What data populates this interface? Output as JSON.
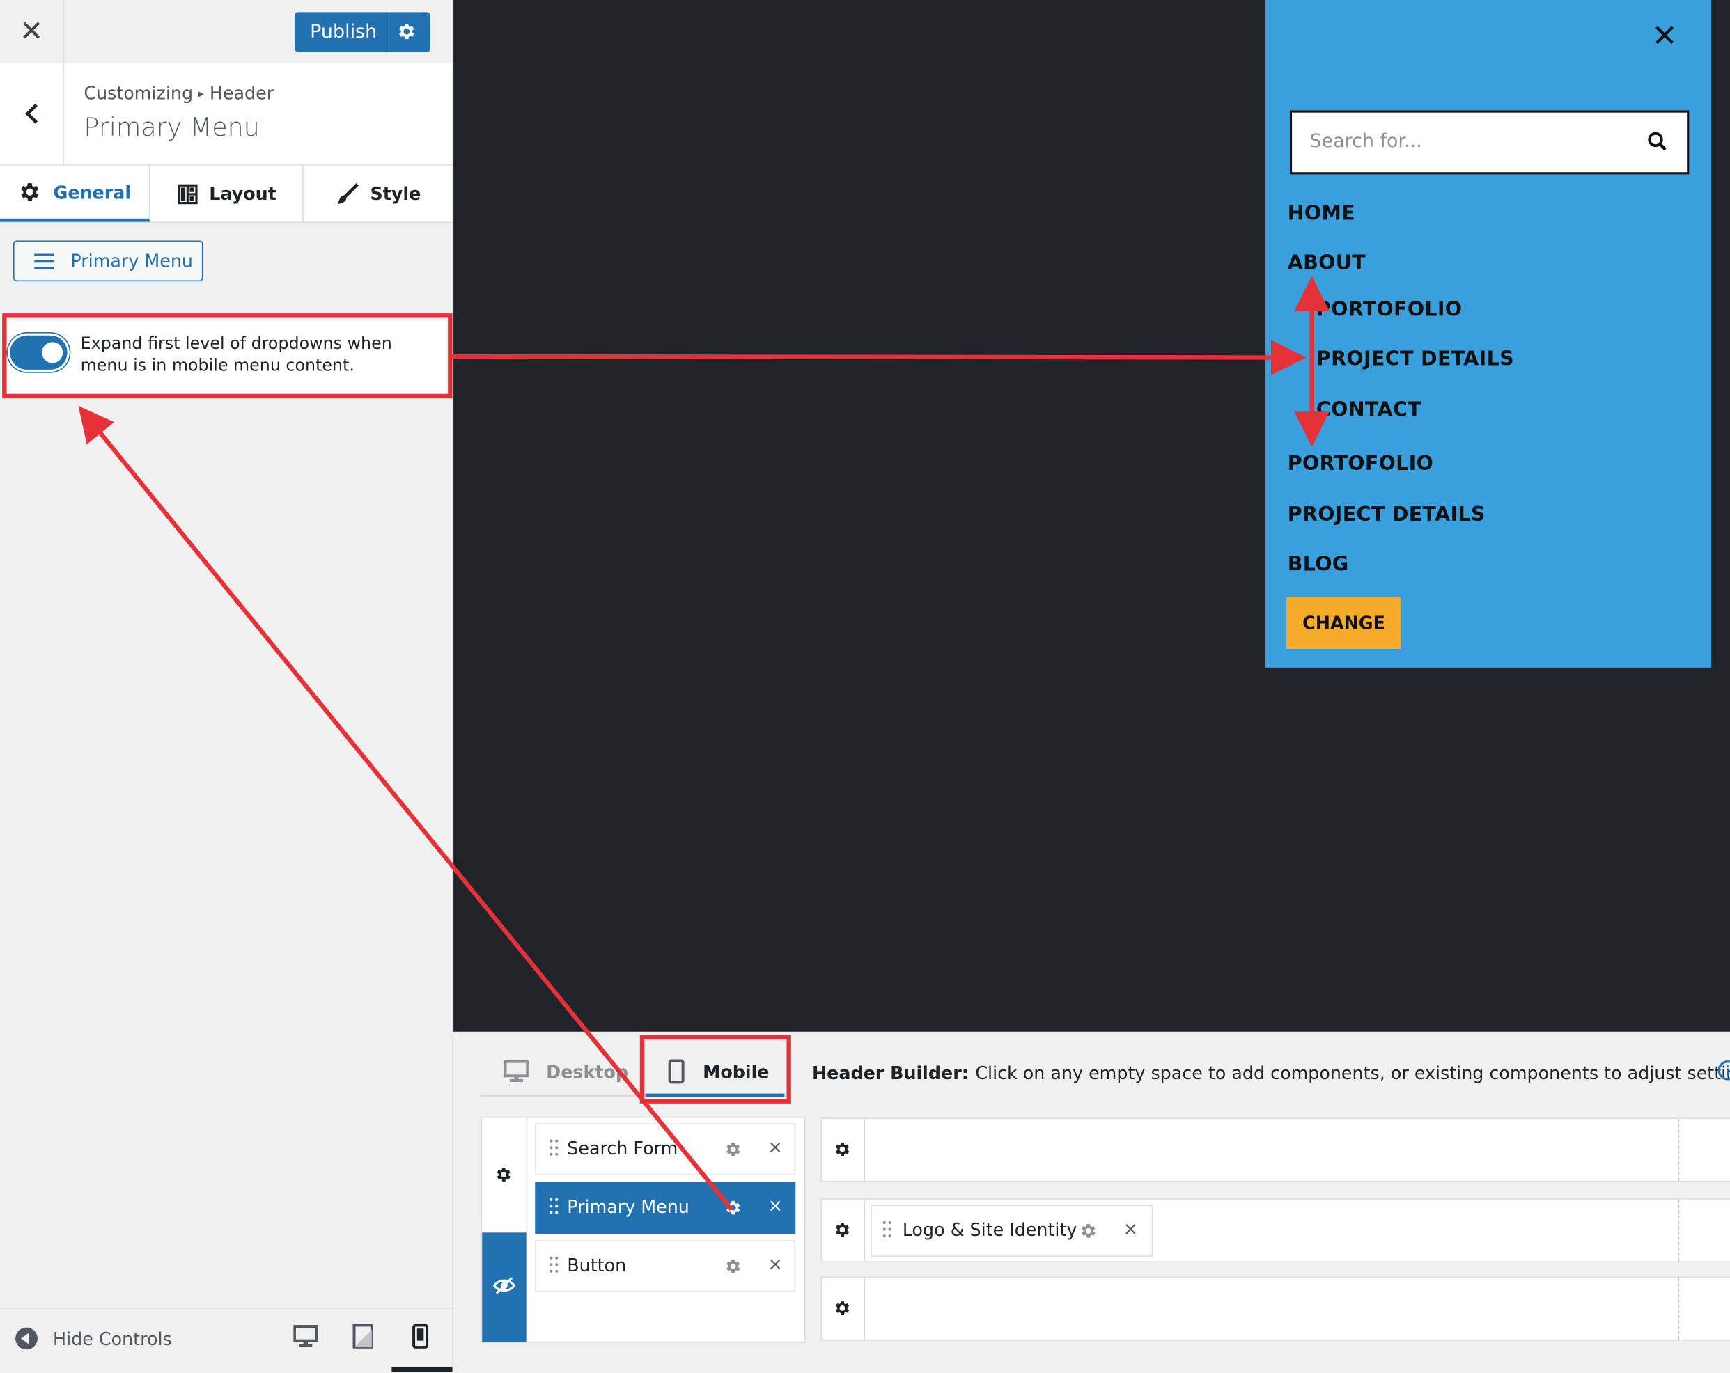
{
  "topbar": {
    "close_glyph": "✕",
    "publish_label": "Publish"
  },
  "panel_header": {
    "crumb_root": "Customizing",
    "crumb_arrow": "▸",
    "crumb_section": "Header",
    "title": "Primary Menu"
  },
  "tabs": [
    {
      "label": "General",
      "icon": "gear-icon",
      "active": true
    },
    {
      "label": "Layout",
      "icon": "layout-icon",
      "active": false
    },
    {
      "label": "Style",
      "icon": "brush-icon",
      "active": false
    }
  ],
  "menu_select": {
    "label": "Primary Menu",
    "icon": "menu-icon"
  },
  "toggle_setting": {
    "label": "Expand first level of dropdowns when menu is in mobile menu content.",
    "enabled": true
  },
  "footer": {
    "hide_controls": "Hide Controls",
    "devices": [
      "desktop-icon",
      "tablet-icon",
      "mobile-icon"
    ],
    "active_device": "mobile"
  },
  "mobile_menu": {
    "close_glyph": "✕",
    "search_placeholder": "Search for...",
    "items": [
      {
        "label": "HOME",
        "level": 0
      },
      {
        "label": "ABOUT",
        "level": 0
      },
      {
        "label": "PORTOFOLIO",
        "level": 1
      },
      {
        "label": "PROJECT DETAILS",
        "level": 1
      },
      {
        "label": "CONTACT",
        "level": 1
      },
      {
        "label": "PORTOFOLIO",
        "level": 0
      },
      {
        "label": "PROJECT DETAILS",
        "level": 0
      },
      {
        "label": "BLOG",
        "level": 0
      }
    ],
    "cta": "CHANGE",
    "colors": {
      "background": "#3a9fdd",
      "cta": "#f6aa2a"
    }
  },
  "builder": {
    "tab_desktop": "Desktop",
    "tab_mobile": "Mobile",
    "title_bold": "Header Builder:",
    "title_text": "Click on any empty space to add components, or existing components to adjust settings.",
    "info_glyph": "i",
    "offcanvas_items": [
      {
        "label": "Search Form",
        "active": false
      },
      {
        "label": "Primary Menu",
        "active": true
      },
      {
        "label": "Button",
        "active": false
      }
    ],
    "row_middle_item": "Logo & Site Identity",
    "remove_glyph": "×"
  },
  "colors": {
    "accent": "#2271b1",
    "annotation": "#e53238",
    "preview_bg": "#202327"
  }
}
